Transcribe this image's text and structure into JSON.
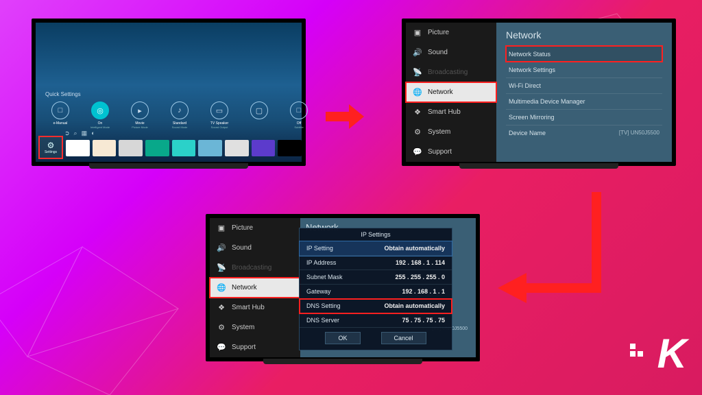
{
  "tv1": {
    "quick_settings_title": "Quick Settings",
    "items": [
      {
        "label": "e-Manual",
        "sub": ""
      },
      {
        "label": "On",
        "sub": "Intelligent Mode"
      },
      {
        "label": "Movie",
        "sub": "Picture Mode"
      },
      {
        "label": "Standard",
        "sub": "Sound Mode"
      },
      {
        "label": "TV Speaker",
        "sub": "Sound Output"
      },
      {
        "label": "",
        "sub": ""
      },
      {
        "label": "Off",
        "sub": "Subtitle"
      }
    ],
    "settings_label": "Settings"
  },
  "tv2": {
    "menu": [
      {
        "label": "Picture"
      },
      {
        "label": "Sound"
      },
      {
        "label": "Broadcasting"
      },
      {
        "label": "Network"
      },
      {
        "label": "Smart Hub"
      },
      {
        "label": "System"
      },
      {
        "label": "Support"
      }
    ],
    "panel_title": "Network",
    "panel_rows": [
      {
        "label": "Network Status"
      },
      {
        "label": "Network Settings"
      },
      {
        "label": "Wi-Fi Direct"
      },
      {
        "label": "Multimedia Device Manager"
      },
      {
        "label": "Screen Mirroring"
      },
      {
        "label": "Device Name",
        "value": "[TV] UN50J5500"
      }
    ]
  },
  "tv3": {
    "menu": [
      {
        "label": "Picture"
      },
      {
        "label": "Sound"
      },
      {
        "label": "Broadcasting"
      },
      {
        "label": "Network"
      },
      {
        "label": "Smart Hub"
      },
      {
        "label": "System"
      },
      {
        "label": "Support"
      }
    ],
    "bg_title": "Network",
    "device": "[TV] UN50J5500",
    "dialog_title": "IP Settings",
    "rows": [
      {
        "k": "IP Setting",
        "v": "Obtain automatically"
      },
      {
        "k": "IP Address",
        "v": "192 . 168 . 1 . 114"
      },
      {
        "k": "Subnet Mask",
        "v": "255 . 255 . 255 . 0"
      },
      {
        "k": "Gateway",
        "v": "192 . 168 . 1 . 1"
      },
      {
        "k": "DNS Setting",
        "v": "Obtain automatically"
      },
      {
        "k": "DNS Server",
        "v": "75 . 75 . 75 . 75"
      }
    ],
    "ok": "OK",
    "cancel": "Cancel"
  },
  "logo": "K"
}
